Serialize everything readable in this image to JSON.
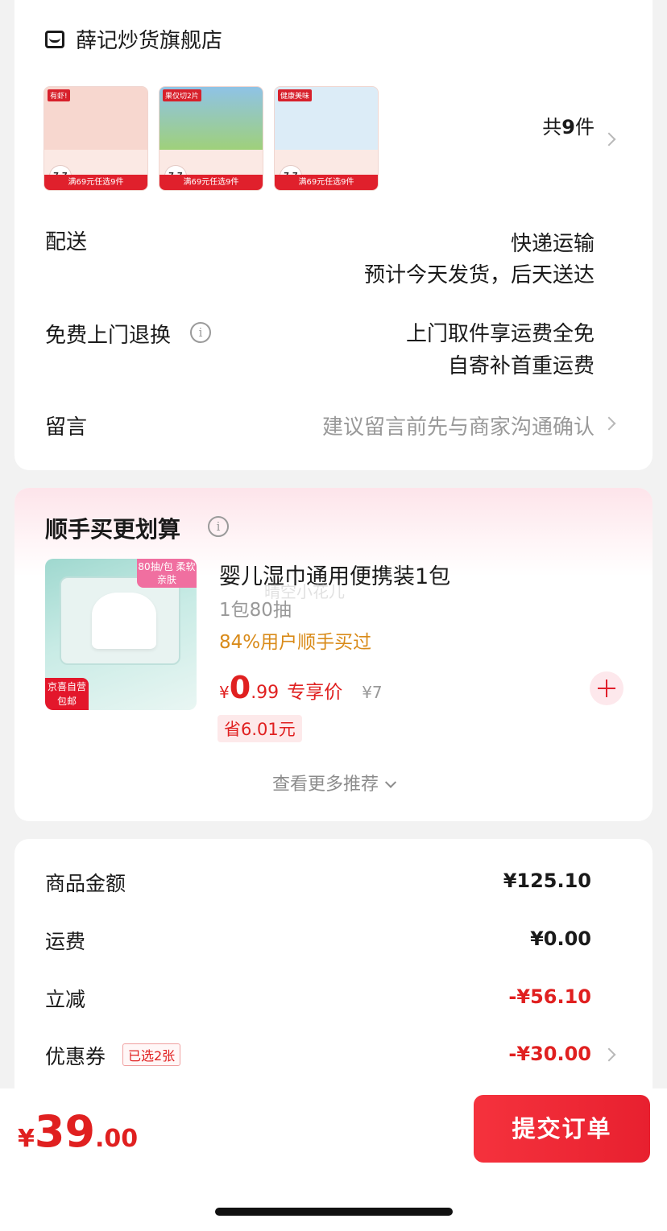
{
  "shop": {
    "name": "薛记炒货旗舰店",
    "thumbnails": [
      {
        "headline": "有虾!",
        "price_badge": "7.7",
        "bottom_text": "满69元任选9件",
        "top_color": "#f7d7cf"
      },
      {
        "headline": "果仅切2片",
        "price_badge": "7.7",
        "bottom_text": "满69元任选9件",
        "top_color": "#8fc3e6"
      },
      {
        "headline": "健康美味",
        "price_badge": "7.7",
        "bottom_text": "满69元任选9件",
        "top_color": "#dcecf7"
      }
    ],
    "count_prefix": "共",
    "count_num": "9",
    "count_suffix": "件",
    "delivery_label": "配送",
    "delivery_method": "快递运输",
    "delivery_eta": "预计今天发货，后天送达",
    "returns_label": "免费上门退换",
    "returns_line1": "上门取件享运费全免",
    "returns_line2": "自寄补首重运费",
    "note_label": "留言",
    "note_placeholder": "建议留言前先与商家沟通确认"
  },
  "addon": {
    "title": "顺手买更划算",
    "product": {
      "name": "婴儿湿巾通用便携装1包",
      "spec": "1包80抽",
      "bought": "84%用户顺手买过",
      "price_symbol": "¥",
      "price_int": "0",
      "price_dec": ".99",
      "price_label": "专享价",
      "original_price": "¥7",
      "save_text": "省6.01元",
      "img_tag": "80抽/包 柔软亲肤",
      "img_badge": "京喜自营 包邮"
    },
    "watermark": "晴空小花儿",
    "see_more": "查看更多推荐"
  },
  "summary": {
    "rows": [
      {
        "label": "商品金额",
        "value": "¥125.10"
      },
      {
        "label": "运费",
        "value": "¥0.00"
      },
      {
        "label": "立减",
        "value": "-¥56.10"
      },
      {
        "label": "优惠券",
        "value": "-¥30.00"
      }
    ],
    "coupon_tag": "已选2张"
  },
  "footer": {
    "total_symbol": "¥",
    "total_int": "39",
    "total_dec": ".00",
    "submit_label": "提交订单"
  },
  "colors": {
    "accent": "#e02020",
    "orange": "#d98b1a"
  }
}
